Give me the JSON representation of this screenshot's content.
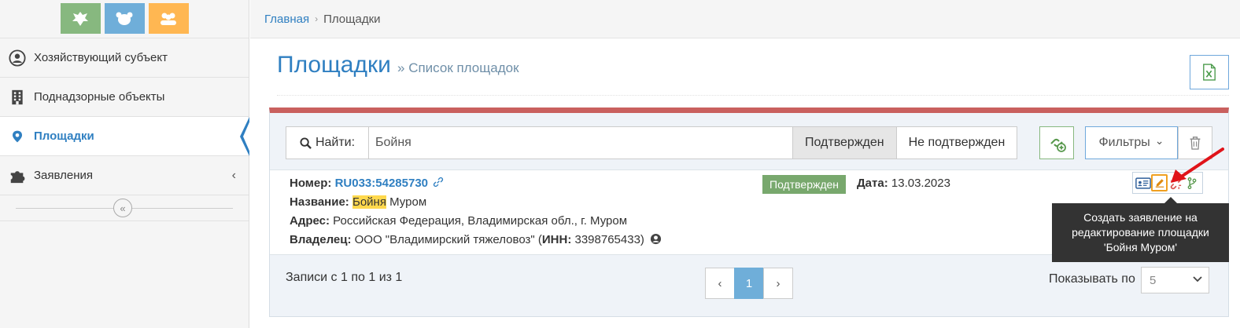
{
  "sidebar": {
    "logos": [
      {
        "icon": "emblem-icon",
        "color": "#87b87f"
      },
      {
        "icon": "cow-icon",
        "color": "#6faed9"
      },
      {
        "icon": "users-icon",
        "color": "#ffb752"
      }
    ],
    "items": [
      {
        "label": "Хозяйствующий субъект",
        "icon": "user-circle-icon"
      },
      {
        "label": "Поднадзорные объекты",
        "icon": "building-icon"
      },
      {
        "label": "Площадки",
        "icon": "map-marker-icon",
        "active": true
      },
      {
        "label": "Заявления",
        "icon": "puzzle-icon",
        "chevron": "‹"
      }
    ],
    "collapse_glyph": "«"
  },
  "breadcrumb": {
    "home": "Главная",
    "separator": "›",
    "current": "Площадки"
  },
  "header": {
    "title": "Площадки",
    "subtitle": "» Список площадок"
  },
  "toolbar": {
    "search_label": "Найти:",
    "search_value": "Бойня",
    "btn_confirmed": "Подтвержден",
    "btn_unconfirmed": "Не подтвержден",
    "filters_label": "Фильтры",
    "filters_chevron": "⌄"
  },
  "record": {
    "number_label": "Номер:",
    "number_value": "RU033:54285730",
    "name_label": "Название:",
    "name_highlight": "Бойня",
    "name_rest": " Муром",
    "address_label": "Адрес:",
    "address_value": "Российская Федерация, Владимирская обл., г. Муром",
    "owner_label": "Владелец:",
    "owner_value": "ООО \"Владимирский тяжеловоз\" (",
    "inn_label": "ИНН:",
    "inn_value": " 3398765433)",
    "status_badge": "Подтвержден",
    "date_label": "Дата:",
    "date_value": "13.03.2023"
  },
  "tooltip": {
    "text_line1": "Создать заявление на",
    "text_line2": "редактирование площадки",
    "text_line3": "'Бойня Муром'"
  },
  "pagination": {
    "info": "Записи с 1 по 1 из 1",
    "prev": "‹",
    "current": "1",
    "next": "›",
    "per_page_label": "Показывать по",
    "per_page_value": "5"
  },
  "colors": {
    "accent": "#2f7fc1",
    "panel_top": "#c9605e",
    "badge_green": "#78a86d",
    "highlight": "#ffd84d"
  }
}
